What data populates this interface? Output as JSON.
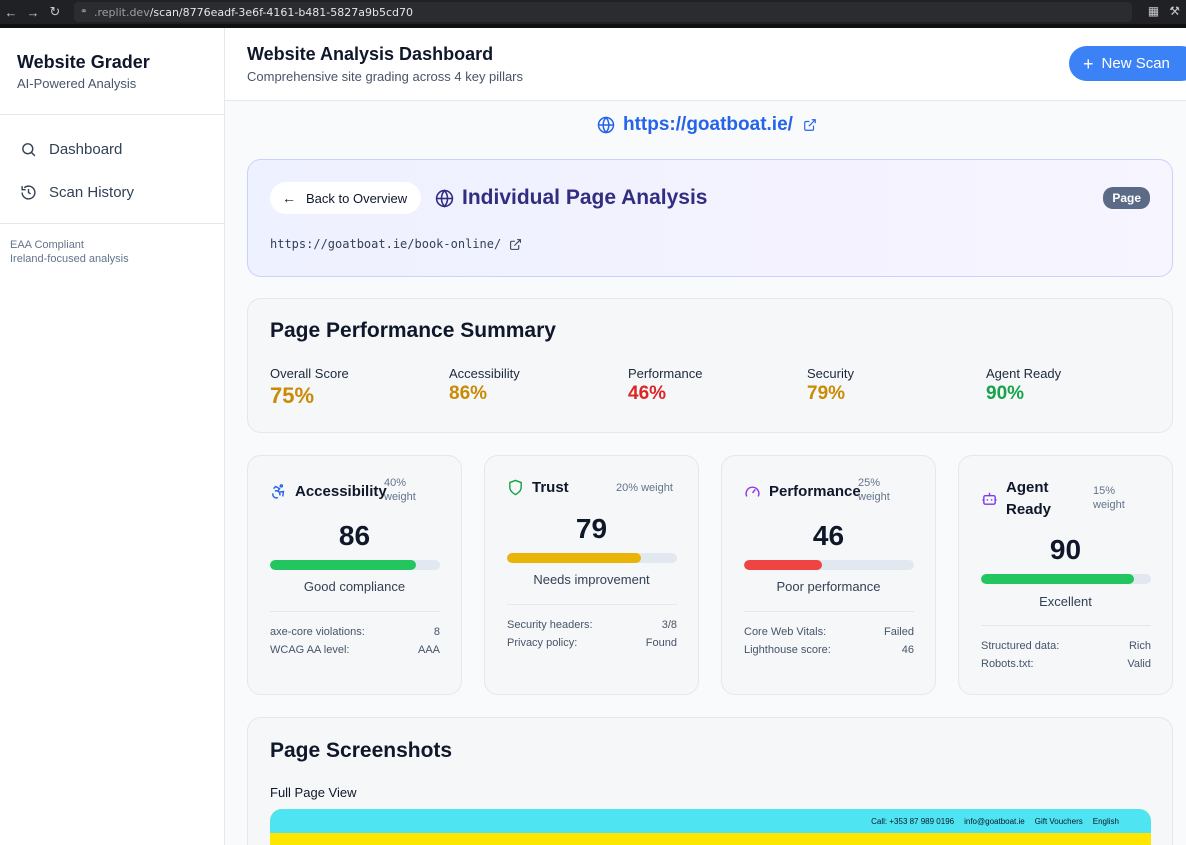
{
  "browser": {
    "url_domain": ".replit.dev",
    "url_path": "/scan/8776eadf-3e6f-4161-b481-5827a9b5cd70"
  },
  "sidebar": {
    "brand_title": "Website Grader",
    "brand_subtitle": "AI-Powered Analysis",
    "items": [
      {
        "label": "Dashboard"
      },
      {
        "label": "Scan History"
      }
    ],
    "footer_line1": "EAA Compliant",
    "footer_line2": "Ireland-focused analysis"
  },
  "header": {
    "title": "Website Analysis Dashboard",
    "subtitle": "Comprehensive site grading across 4 key pillars",
    "new_scan_label": "New Scan"
  },
  "main": {
    "site_url": "https://goatboat.ie/",
    "page_card": {
      "back_label": "Back to Overview",
      "title": "Individual Page Analysis",
      "badge": "Page",
      "page_url": "https://goatboat.ie/book-online/"
    },
    "summary": {
      "title": "Page Performance Summary",
      "metrics": [
        {
          "label": "Overall Score",
          "value": "75%",
          "color": "#ca8a04"
        },
        {
          "label": "Accessibility",
          "value": "86%",
          "color": "#ca8a04"
        },
        {
          "label": "Performance",
          "value": "46%",
          "color": "#dc2626"
        },
        {
          "label": "Security",
          "value": "79%",
          "color": "#ca8a04"
        },
        {
          "label": "Agent Ready",
          "value": "90%",
          "color": "#16a34a"
        }
      ]
    },
    "pillars": [
      {
        "name": "Accessibility",
        "weight_num": "40%",
        "weight_word": "weight",
        "score": "86",
        "progress": 0.86,
        "bar_color": "#22c55e",
        "status": "Good compliance",
        "rows": [
          {
            "label": "axe-core violations:",
            "value": "8"
          },
          {
            "label": "WCAG AA level:",
            "value": "AAA"
          }
        ]
      },
      {
        "name": "Trust",
        "weight": "20% weight",
        "score": "79",
        "progress": 0.79,
        "bar_color": "#eab308",
        "status": "Needs improvement",
        "rows": [
          {
            "label": "Security headers:",
            "value": "3/8"
          },
          {
            "label": "Privacy policy:",
            "value": "Found"
          }
        ]
      },
      {
        "name": "Performance",
        "weight_num": "25%",
        "weight_word": "weight",
        "score": "46",
        "progress": 0.46,
        "bar_color": "#ef4444",
        "status": "Poor performance",
        "rows": [
          {
            "label": "Core Web Vitals:",
            "value": "Failed"
          },
          {
            "label": "Lighthouse score:",
            "value": "46"
          }
        ]
      },
      {
        "name_line1": "Agent",
        "name_line2": "Ready",
        "weight_num": "15%",
        "weight_word": "weight",
        "score": "90",
        "progress": 0.9,
        "bar_color": "#22c55e",
        "status": "Excellent",
        "rows": [
          {
            "label": "Structured data:",
            "value": "Rich"
          },
          {
            "label": "Robots.txt:",
            "value": "Valid"
          }
        ]
      }
    ],
    "screenshots": {
      "title": "Page Screenshots",
      "subtitle": "Full Page View",
      "preview_items": [
        "Call: +353 87 989 0196",
        "info@goatboat.ie",
        "Gift Vouchers",
        "English"
      ]
    }
  }
}
